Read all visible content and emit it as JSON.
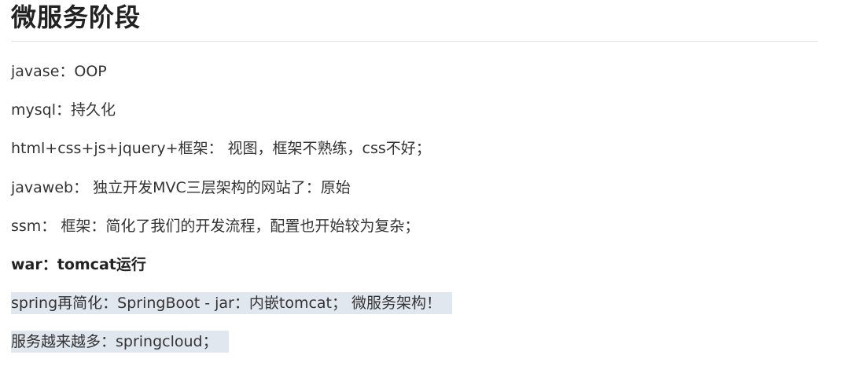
{
  "heading": "微服务阶段",
  "lines": [
    {
      "text": "javase：OOP"
    },
    {
      "text": "mysql：持久化"
    },
    {
      "text": "html+css+js+jquery+框架： 视图，框架不熟练，css不好；"
    },
    {
      "text": "javaweb： 独立开发MVC三层架构的网站了：原始"
    },
    {
      "text": "ssm： 框架：简化了我们的开发流程，配置也开始较为复杂；"
    },
    {
      "text": "war：tomcat运行"
    },
    {
      "text": "spring再简化：SpringBoot - jar：内嵌tomcat；   微服务架构！"
    },
    {
      "text": "服务越来越多：springcloud；"
    }
  ],
  "colors": {
    "text": "#333333",
    "heading": "#222222",
    "highlight": "#e1e7ef",
    "rule": "#e4e4e4"
  }
}
